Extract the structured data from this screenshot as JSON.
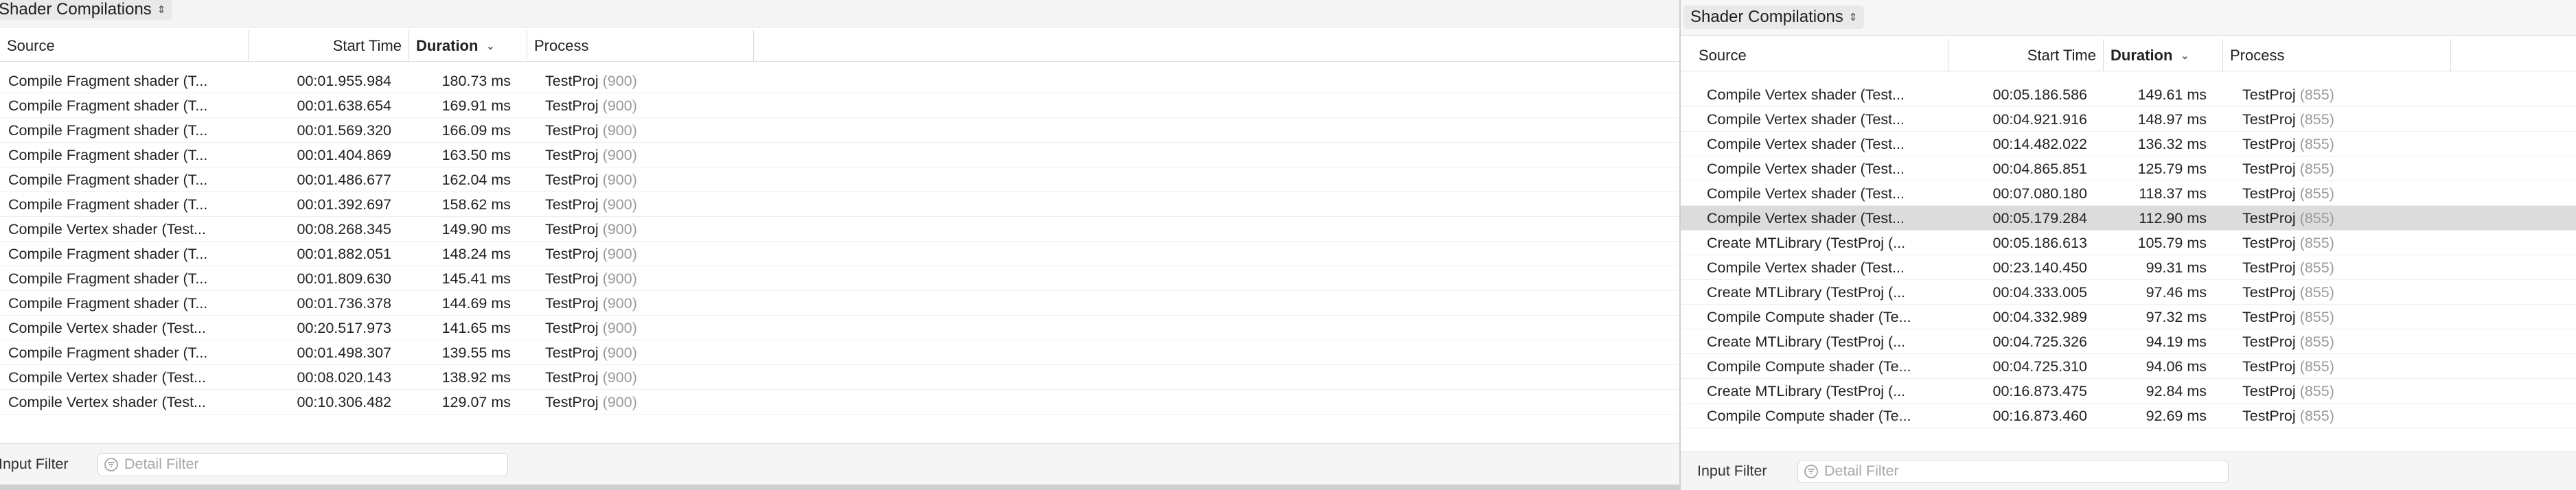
{
  "left": {
    "instrument": "Shader Compilations",
    "columns": {
      "source": "Source",
      "start": "Start Time",
      "duration": "Duration",
      "process": "Process"
    },
    "rows": [
      {
        "source": "Compile Fragment shader (T...",
        "start": "00:01.955.984",
        "duration": "180.73 ms",
        "process": "TestProj",
        "pid": "(900)"
      },
      {
        "source": "Compile Fragment shader (T...",
        "start": "00:01.638.654",
        "duration": "169.91 ms",
        "process": "TestProj",
        "pid": "(900)"
      },
      {
        "source": "Compile Fragment shader (T...",
        "start": "00:01.569.320",
        "duration": "166.09 ms",
        "process": "TestProj",
        "pid": "(900)"
      },
      {
        "source": "Compile Fragment shader (T...",
        "start": "00:01.404.869",
        "duration": "163.50 ms",
        "process": "TestProj",
        "pid": "(900)"
      },
      {
        "source": "Compile Fragment shader (T...",
        "start": "00:01.486.677",
        "duration": "162.04 ms",
        "process": "TestProj",
        "pid": "(900)"
      },
      {
        "source": "Compile Fragment shader (T...",
        "start": "00:01.392.697",
        "duration": "158.62 ms",
        "process": "TestProj",
        "pid": "(900)"
      },
      {
        "source": "Compile Vertex shader (Test...",
        "start": "00:08.268.345",
        "duration": "149.90 ms",
        "process": "TestProj",
        "pid": "(900)"
      },
      {
        "source": "Compile Fragment shader (T...",
        "start": "00:01.882.051",
        "duration": "148.24 ms",
        "process": "TestProj",
        "pid": "(900)"
      },
      {
        "source": "Compile Fragment shader (T...",
        "start": "00:01.809.630",
        "duration": "145.41 ms",
        "process": "TestProj",
        "pid": "(900)"
      },
      {
        "source": "Compile Fragment shader (T...",
        "start": "00:01.736.378",
        "duration": "144.69 ms",
        "process": "TestProj",
        "pid": "(900)"
      },
      {
        "source": "Compile Vertex shader (Test...",
        "start": "00:20.517.973",
        "duration": "141.65 ms",
        "process": "TestProj",
        "pid": "(900)"
      },
      {
        "source": "Compile Fragment shader (T...",
        "start": "00:01.498.307",
        "duration": "139.55 ms",
        "process": "TestProj",
        "pid": "(900)"
      },
      {
        "source": "Compile Vertex shader (Test...",
        "start": "00:08.020.143",
        "duration": "138.92 ms",
        "process": "TestProj",
        "pid": "(900)"
      },
      {
        "source": "Compile Vertex shader (Test...",
        "start": "00:10.306.482",
        "duration": "129.07 ms",
        "process": "TestProj",
        "pid": "(900)"
      }
    ],
    "filter": {
      "label": "Input Filter",
      "placeholder": "Detail Filter"
    }
  },
  "right": {
    "instrument": "Shader Compilations",
    "columns": {
      "source": "Source",
      "start": "Start Time",
      "duration": "Duration",
      "process": "Process"
    },
    "selected_index": 5,
    "rows": [
      {
        "source": "Compile Vertex shader (Test...",
        "start": "00:05.186.586",
        "duration": "149.61 ms",
        "process": "TestProj",
        "pid": "(855)"
      },
      {
        "source": "Compile Vertex shader (Test...",
        "start": "00:04.921.916",
        "duration": "148.97 ms",
        "process": "TestProj",
        "pid": "(855)"
      },
      {
        "source": "Compile Vertex shader (Test...",
        "start": "00:14.482.022",
        "duration": "136.32 ms",
        "process": "TestProj",
        "pid": "(855)"
      },
      {
        "source": "Compile Vertex shader (Test...",
        "start": "00:04.865.851",
        "duration": "125.79 ms",
        "process": "TestProj",
        "pid": "(855)"
      },
      {
        "source": "Compile Vertex shader (Test...",
        "start": "00:07.080.180",
        "duration": "118.37 ms",
        "process": "TestProj",
        "pid": "(855)"
      },
      {
        "source": "Compile Vertex shader (Test...",
        "start": "00:05.179.284",
        "duration": "112.90 ms",
        "process": "TestProj",
        "pid": "(855)"
      },
      {
        "source": "Create MTLibrary (TestProj (...",
        "start": "00:05.186.613",
        "duration": "105.79 ms",
        "process": "TestProj",
        "pid": "(855)"
      },
      {
        "source": "Compile Vertex shader (Test...",
        "start": "00:23.140.450",
        "duration": "99.31 ms",
        "process": "TestProj",
        "pid": "(855)"
      },
      {
        "source": "Create MTLibrary (TestProj (...",
        "start": "00:04.333.005",
        "duration": "97.46 ms",
        "process": "TestProj",
        "pid": "(855)"
      },
      {
        "source": "Compile Compute shader (Te...",
        "start": "00:04.332.989",
        "duration": "97.32 ms",
        "process": "TestProj",
        "pid": "(855)"
      },
      {
        "source": "Create MTLibrary (TestProj (...",
        "start": "00:04.725.326",
        "duration": "94.19 ms",
        "process": "TestProj",
        "pid": "(855)"
      },
      {
        "source": "Compile Compute shader (Te...",
        "start": "00:04.725.310",
        "duration": "94.06 ms",
        "process": "TestProj",
        "pid": "(855)"
      },
      {
        "source": "Create MTLibrary (TestProj (...",
        "start": "00:16.873.475",
        "duration": "92.84 ms",
        "process": "TestProj",
        "pid": "(855)"
      },
      {
        "source": "Compile Compute shader (Te...",
        "start": "00:16.873.460",
        "duration": "92.69 ms",
        "process": "TestProj",
        "pid": "(855)"
      }
    ],
    "filter": {
      "label": "Input Filter",
      "placeholder": "Detail Filter"
    }
  },
  "icons": {
    "sort": "chevron-down-icon",
    "updown": "updown-arrows-icon",
    "filter": "filter-icon"
  },
  "colors": {
    "selected_row": "#dcdcdc",
    "pid_text": "#9a9a9a"
  }
}
